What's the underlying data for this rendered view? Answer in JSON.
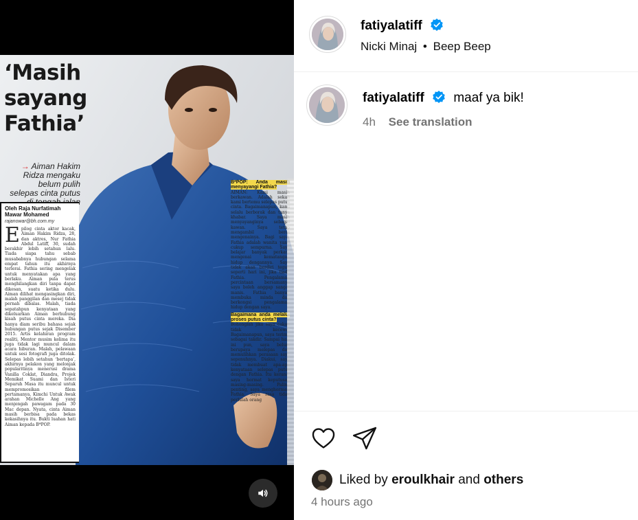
{
  "post": {
    "username": "fatiyalatiff",
    "audio_artist": "Nicki Minaj",
    "audio_separator": "•",
    "audio_track": "Beep Beep"
  },
  "caption": {
    "username": "fatiyalatiff",
    "text": "maaf ya bik!",
    "time": "4h",
    "see_translation": "See translation"
  },
  "likes": {
    "prefix": "Liked by",
    "user": "eroulkhair",
    "and": "and",
    "others": "others"
  },
  "timestamp": "4 hours ago",
  "magazine": {
    "headline_1": "‘Masih",
    "headline_2": "sayang",
    "headline_3": "Fathia’",
    "subhead": "Aiman Hakim Ridza mengaku belum pulih selepas cinta putus di tengah jalan",
    "author_1": "Oleh Raja Nurfatimah",
    "author_2": "Mawar Mohamed",
    "email": "rajanowar@bh.com.my",
    "body_left": "pilog cinta aktor kacak, Aiman Hakim Ridza, 28, dan aktres, Nur Fathia Abdul Latiff, 30, sudah berakhir lebih setahun lalu. Tiada siapa tahu sebab musababnya hubungan selama empat tahun itu akhirnya terlerai. Fathia sering mengelak untuk menyatakan apa yang berlaku. Aiman pula terus menghilangkan diri tanpa dapat dikesan, suatu ketika dulu. Aiman dilihat mengasingkan diri, malah panggilan dan mesej tidak pernah dibalas. Malah, tiada sepatahpun kenyataan yang dikeluarkan Aiman berhubung kisah putus cinta mereka. Dia hanya diam seribu bahasa sejak hubungan putus sejak Disember 2015. Artis kelahiran program realiti, Mentor musim kelima itu juga tidak lagi muncul dalam acara hiburan. Malah, pelawaan untuk sesi fotografi juga ditolak. Selepas lebih setahun ‘bertapa’, akhirnya pelakon yang melonjak popularitinya menerusi drama Vanilla Coklat, Diandra, Projek Memikat Suami dan Isteri Separuh Masa itu muncul untuk mempromosikan filem pertamanya, Kimchi Untuk Awak arahan Michelle Ang yang menjengah pawagam pada 30 Mac depan. Nyata, cinta Aiman masih berbisa pada bekas kekasihnya itu. Bukti luahan hati Aiman kepada B*POP.",
    "q1": "B*POP: Anda masih menyayangi Fathia?",
    "a1": "AIMAN: Kami masih berkawan. Adalah sekali kami bertemu selepas putus cinta. Bagaimanapun, kami selalu berborak dan tanya khabar. Saya masih menyayanginya sebagai kawan. Saya tetap mengambil berat mengenainya. Bagi saya, Fathia adalah wanita yang cukup sempurna. Saya belajar banyak perkara mengenai kematangan hidup dengannya. Saya tidak akan berdiri teguh seperti hari ini, jika tiada Fathia. Pengalaman percintaan bersamanya saya boleh anggap sangat manis. Fathia banyak membuka minda dan berkongsi pengalaman hidup dengan saya.",
    "q2": "Bagaimana anda melalui proses putus cinta?",
    "a2": "Bohonglah jika saya cakap tidak kecewa. Bagaimanapun, saya terima sebagai takdir. Sampai hari ini pun, saya belum berupaya melepas dan memulihkan perasaan saya sepenuhnya. Diakui, saya tidak membuat apa-apa kenyataan selepas putus dengan Fathia. Itu kerana, saya hormat keputusan masing-masing. Paling penting, saya menghormati Fathia. Saya rasa tidak perlulah orang"
  },
  "colors": {
    "verified": "#0095f6",
    "secondary_text": "#737373",
    "divider": "#efefef"
  },
  "icons": [
    "verified-badge-icon",
    "heart-icon",
    "share-icon",
    "speaker-icon"
  ]
}
